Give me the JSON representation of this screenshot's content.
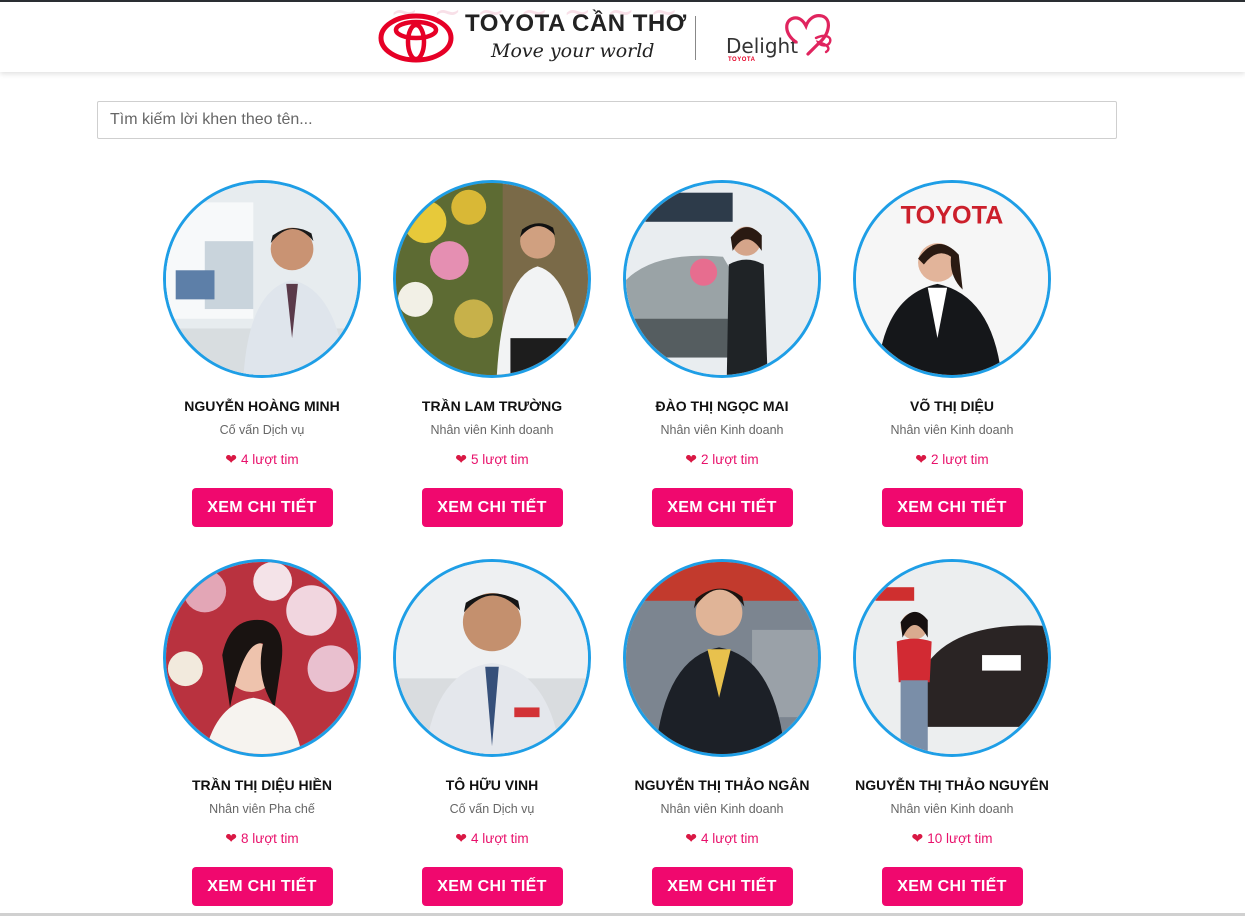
{
  "header": {
    "brand_name": "TOYOTA CẦN THƠ",
    "slogan": "Move your world",
    "delight_text": "Delight",
    "delight_sub": "TOYOTA",
    "brand_color": "#e60026",
    "heart_color": "#e0245e",
    "icons": [
      "toyota-emblem-icon",
      "delight-heart-icon"
    ]
  },
  "search": {
    "placeholder": "Tìm kiếm lời khen theo tên..."
  },
  "theme": {
    "accent": "#f0086e",
    "avatar_border": "#1e9ee6",
    "likes_color": "#e8116b"
  },
  "staff": [
    {
      "name": "NGUYỄN HOÀNG MINH",
      "role": "Cố vấn Dịch vụ",
      "likes": "4 lượt tim",
      "button": "XEM CHI TIẾT"
    },
    {
      "name": "TRẦN LAM TRƯỜNG",
      "role": "Nhân viên Kinh doanh",
      "likes": "5 lượt tim",
      "button": "XEM CHI TIẾT"
    },
    {
      "name": "ĐÀO THỊ NGỌC MAI",
      "role": "Nhân viên Kinh doanh",
      "likes": "2 lượt tim",
      "button": "XEM CHI TIẾT"
    },
    {
      "name": "VÕ THỊ DIỆU",
      "role": "Nhân viên Kinh doanh",
      "likes": "2 lượt tim",
      "button": "XEM CHI TIẾT"
    },
    {
      "name": "TRẦN THỊ DIỆU HIỀN",
      "role": "Nhân viên Pha chế",
      "likes": "8 lượt tim",
      "button": "XEM CHI TIẾT"
    },
    {
      "name": "TÔ HỮU VINH",
      "role": "Cố vấn Dịch vụ",
      "likes": "4 lượt tim",
      "button": "XEM CHI TIẾT"
    },
    {
      "name": "NGUYỄN THỊ THẢO NGÂN",
      "role": "Nhân viên Kinh doanh",
      "likes": "4 lượt tim",
      "button": "XEM CHI TIẾT"
    },
    {
      "name": "NGUYỄN THỊ THẢO NGUYÊN",
      "role": "Nhân viên Kinh doanh",
      "likes": "10 lượt tim",
      "button": "XEM CHI TIẾT"
    }
  ]
}
